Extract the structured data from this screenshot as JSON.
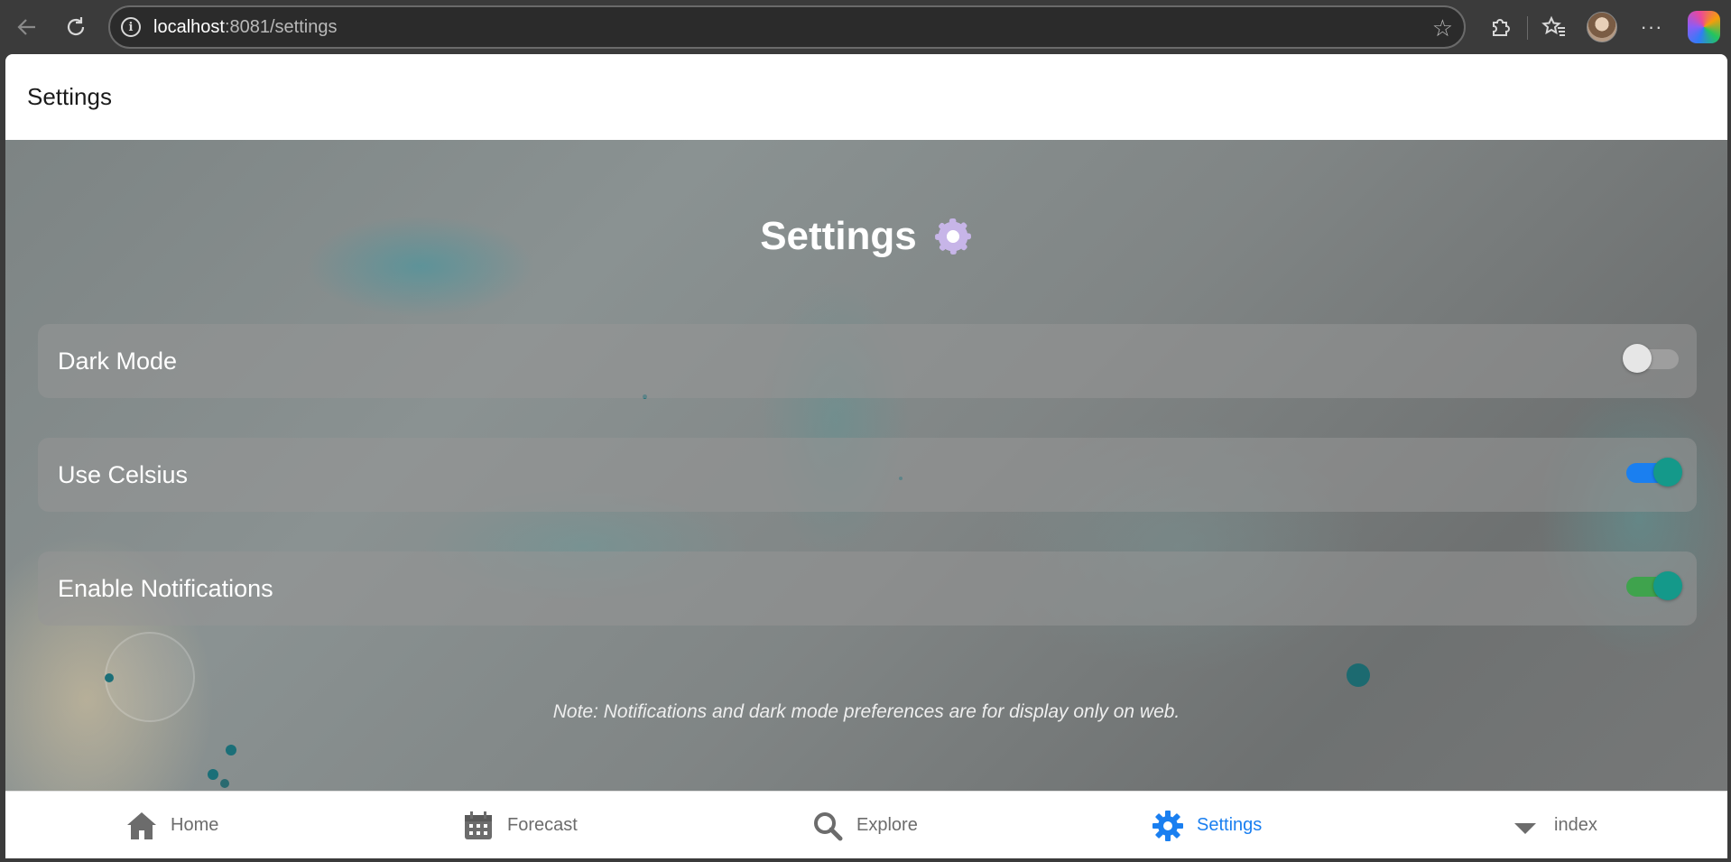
{
  "browser": {
    "url_host": "localhost",
    "url_rest": ":8081/settings"
  },
  "app": {
    "header_title": "Settings",
    "page_title": "Settings",
    "settings": [
      {
        "label": "Dark Mode",
        "enabled": false,
        "accent": "#9e9e9e"
      },
      {
        "label": "Use Celsius",
        "enabled": true,
        "accent": "#1a7ff0"
      },
      {
        "label": "Enable Notifications",
        "enabled": true,
        "accent": "#3fa34d"
      }
    ],
    "note": "Note: Notifications and dark mode preferences are for display only on web."
  },
  "tabs": [
    {
      "label": "Home",
      "icon": "home-icon",
      "active": false
    },
    {
      "label": "Forecast",
      "icon": "calendar-icon",
      "active": false
    },
    {
      "label": "Explore",
      "icon": "search-icon",
      "active": false
    },
    {
      "label": "Settings",
      "icon": "gear-icon",
      "active": true
    },
    {
      "label": "index",
      "icon": "caret-down-icon",
      "active": false
    }
  ],
  "colors": {
    "active_tab": "#1a7ff0",
    "inactive_tab": "#6c6c6c",
    "toggle_knob_on": "#14998a"
  }
}
